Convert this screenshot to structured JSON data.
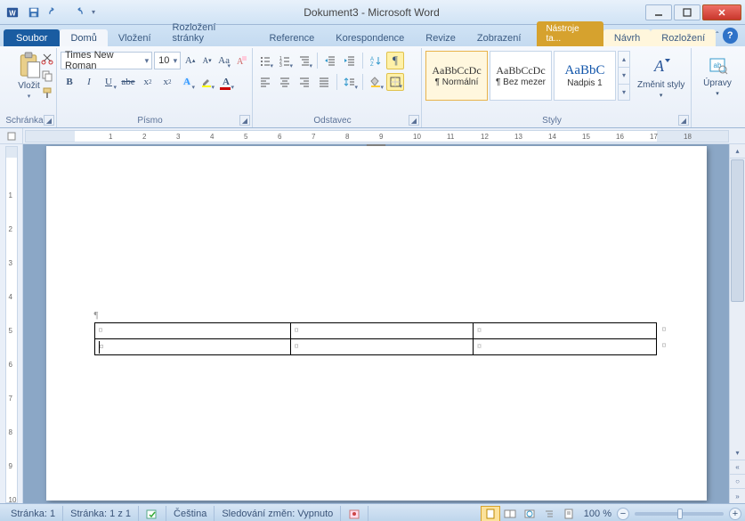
{
  "window": {
    "title": "Dokument3 - Microsoft Word"
  },
  "tabs": {
    "file": "Soubor",
    "items": [
      "Domů",
      "Vložení",
      "Rozložení stránky",
      "Reference",
      "Korespondence",
      "Revize",
      "Zobrazení"
    ],
    "active": 0,
    "context_title": "Nástroje ta...",
    "context_tabs": [
      "Návrh",
      "Rozložení"
    ]
  },
  "ribbon": {
    "clipboard": {
      "label": "Schránka",
      "paste": "Vložit"
    },
    "font": {
      "label": "Písmo",
      "name": "Times New Roman",
      "size": "10"
    },
    "paragraph": {
      "label": "Odstavec"
    },
    "styles": {
      "label": "Styly",
      "tiles": [
        {
          "sample": "AaBbCcDc",
          "name": "¶ Normální"
        },
        {
          "sample": "AaBbCcDc",
          "name": "¶ Bez mezer"
        },
        {
          "sample": "AaBbC",
          "name": "Nadpis 1"
        }
      ],
      "change": "Změnit styly"
    },
    "editing": {
      "label": "Úpravy"
    }
  },
  "table": {
    "rows": 2,
    "cols": 3,
    "cellmark": "¤"
  },
  "status": {
    "page": "Stránka: 1",
    "pages": "Stránka: 1 z 1",
    "lang": "Čeština",
    "track": "Sledování změn: Vypnuto",
    "zoom": "100 %"
  }
}
